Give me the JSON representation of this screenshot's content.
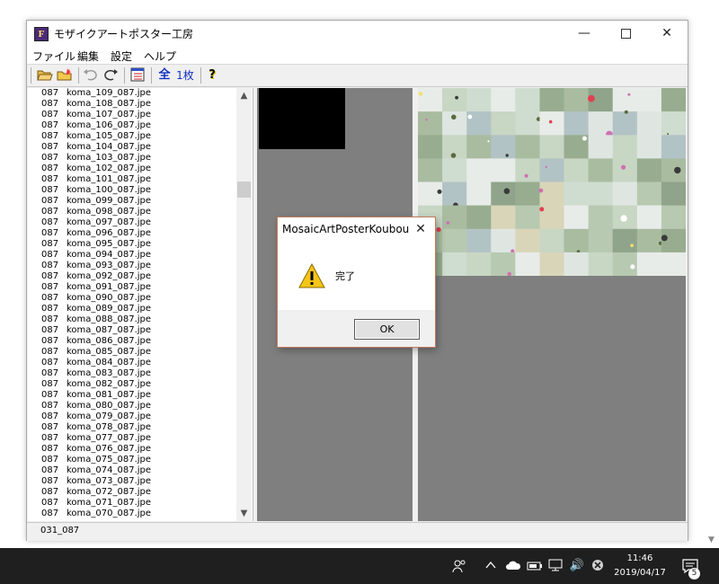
{
  "window": {
    "title": "モザイクアートポスター工房",
    "app_icon_letter": "F",
    "minimize_glyph": "—",
    "close_glyph": "✕"
  },
  "menu": [
    "ファイル",
    "編集",
    "設定",
    "ヘルプ"
  ],
  "toolbar": {
    "all_label": "全",
    "one_sheet_label": "1枚",
    "help_label": "?"
  },
  "file_list": [
    {
      "num": "087",
      "name": "koma_109_087.jpe"
    },
    {
      "num": "087",
      "name": "koma_108_087.jpe"
    },
    {
      "num": "087",
      "name": "koma_107_087.jpe"
    },
    {
      "num": "087",
      "name": "koma_106_087.jpe"
    },
    {
      "num": "087",
      "name": "koma_105_087.jpe"
    },
    {
      "num": "087",
      "name": "koma_104_087.jpe"
    },
    {
      "num": "087",
      "name": "koma_103_087.jpe"
    },
    {
      "num": "087",
      "name": "koma_102_087.jpe"
    },
    {
      "num": "087",
      "name": "koma_101_087.jpe"
    },
    {
      "num": "087",
      "name": "koma_100_087.jpe"
    },
    {
      "num": "087",
      "name": "koma_099_087.jpe"
    },
    {
      "num": "087",
      "name": "koma_098_087.jpe"
    },
    {
      "num": "087",
      "name": "koma_097_087.jpe"
    },
    {
      "num": "087",
      "name": "koma_096_087.jpe"
    },
    {
      "num": "087",
      "name": "koma_095_087.jpe"
    },
    {
      "num": "087",
      "name": "koma_094_087.jpe"
    },
    {
      "num": "087",
      "name": "koma_093_087.jpe"
    },
    {
      "num": "087",
      "name": "koma_092_087.jpe"
    },
    {
      "num": "087",
      "name": "koma_091_087.jpe"
    },
    {
      "num": "087",
      "name": "koma_090_087.jpe"
    },
    {
      "num": "087",
      "name": "koma_089_087.jpe"
    },
    {
      "num": "087",
      "name": "koma_088_087.jpe"
    },
    {
      "num": "087",
      "name": "koma_087_087.jpe"
    },
    {
      "num": "087",
      "name": "koma_086_087.jpe"
    },
    {
      "num": "087",
      "name": "koma_085_087.jpe"
    },
    {
      "num": "087",
      "name": "koma_084_087.jpe"
    },
    {
      "num": "087",
      "name": "koma_083_087.jpe"
    },
    {
      "num": "087",
      "name": "koma_082_087.jpe"
    },
    {
      "num": "087",
      "name": "koma_081_087.jpe"
    },
    {
      "num": "087",
      "name": "koma_080_087.jpe"
    },
    {
      "num": "087",
      "name": "koma_079_087.jpe"
    },
    {
      "num": "087",
      "name": "koma_078_087.jpe"
    },
    {
      "num": "087",
      "name": "koma_077_087.jpe"
    },
    {
      "num": "087",
      "name": "koma_076_087.jpe"
    },
    {
      "num": "087",
      "name": "koma_075_087.jpe"
    },
    {
      "num": "087",
      "name": "koma_074_087.jpe"
    },
    {
      "num": "087",
      "name": "koma_073_087.jpe"
    },
    {
      "num": "087",
      "name": "koma_072_087.jpe"
    },
    {
      "num": "087",
      "name": "koma_071_087.jpe"
    },
    {
      "num": "087",
      "name": "koma_070_087.jpe"
    }
  ],
  "status": {
    "text": "031_087"
  },
  "dialog": {
    "title": "MosaicArtPosterKoubou",
    "message": "完了",
    "ok_label": "OK",
    "icon": "warning-icon"
  },
  "taskbar": {
    "time": "11:46",
    "date": "2019/04/17",
    "notification_count": "5",
    "volume_glyph": "🔊"
  },
  "colors": {
    "pane_gray": "#7f7f7f",
    "taskbar": "#1f1f1f",
    "dialog_border": "#c07a5a",
    "mosaic_tints": [
      "#c8d6c4",
      "#a9bca0",
      "#dfe6e2",
      "#b7c9b0",
      "#e8ece9",
      "#98ad8f",
      "#cfdcd0",
      "#b2c3c5",
      "#d9d5b9",
      "#8fa48a"
    ]
  }
}
